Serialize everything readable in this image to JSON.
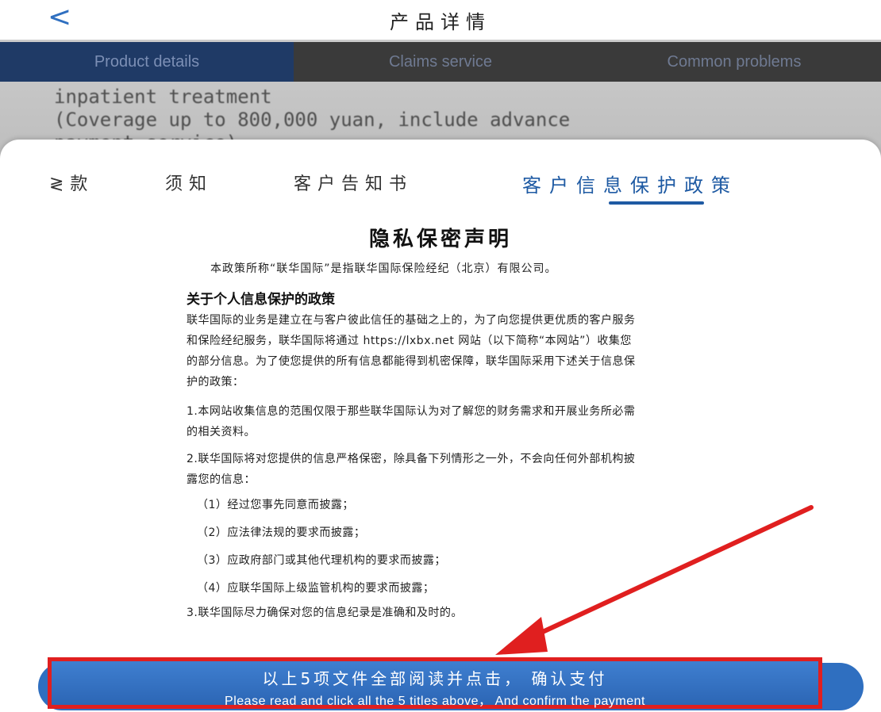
{
  "header": {
    "back_label": "<",
    "title": "产品详情"
  },
  "background_page": {
    "tabs": [
      {
        "label": "Product details",
        "active": true
      },
      {
        "label": "Claims service",
        "active": false
      },
      {
        "label": "Common problems",
        "active": false
      }
    ],
    "text_lines": [
      "inpatient treatment",
      "(Coverage up to 800,000 yuan, include advance",
      "payment service)"
    ]
  },
  "doc_tabs": [
    {
      "label": "条款",
      "display": "≷款",
      "active": false
    },
    {
      "label": "须知",
      "active": false
    },
    {
      "label": "客户告知书",
      "active": false
    },
    {
      "label": "客户信息保护政策",
      "active": true
    }
  ],
  "document": {
    "heading": "隐私保密声明",
    "intro": "本政策所称“联华国际”是指联华国际保险经纪（北京）有限公司。",
    "subheading": "关于个人信息保护的政策",
    "paragraph1": "联华国际的业务是建立在与客户彼此信任的基础之上的，为了向您提供更优质的客户服务和保险经纪服务，联华国际将通过 https://lxbx.net 网站（以下简称“本网站”）收集您的部分信息。为了使您提供的所有信息都能得到机密保障，联华国际采用下述关于信息保护的政策：",
    "paragraph2": "1.本网站收集信息的范围仅限于那些联华国际认为对了解您的财务需求和开展业务所必需的相关资料。",
    "paragraph3": "2.联华国际将对您提供的信息严格保密，除具备下列情形之一外，不会向任何外部机构披露您的信息：",
    "list": [
      "（1）经过您事先同意而披露；",
      "（2）应法律法规的要求而披露；",
      "（3）应政府部门或其他代理机构的要求而披露；",
      "（4）应联华国际上级监管机构的要求而披露；"
    ],
    "paragraph4": "3.联华国际尽力确保对您的信息纪录是准确和及时的。"
  },
  "pay_button": {
    "label_cn": "以上5项文件全部阅读并点击， 确认支付",
    "label_en": "Please read and click all the 5 titles above， And confirm the payment"
  },
  "colors": {
    "accent": "#1e5aa3",
    "button": "#2f6fc0",
    "annotation_red": "#e01f1f"
  }
}
